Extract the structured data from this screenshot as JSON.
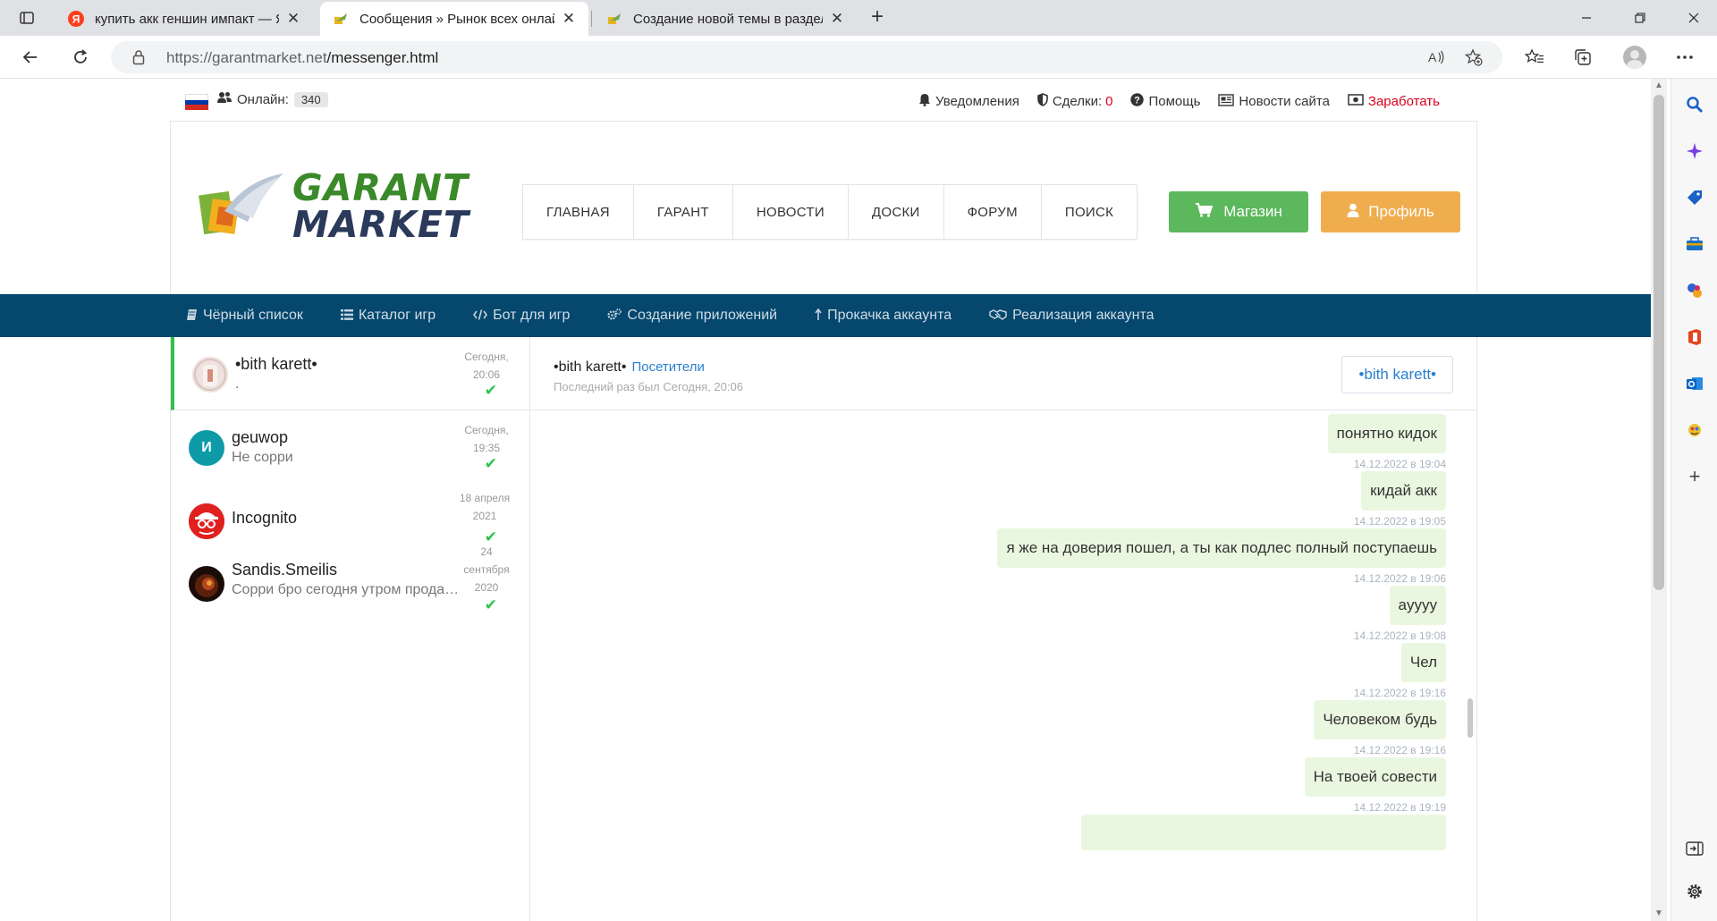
{
  "browser": {
    "tabs": [
      {
        "title": "купить акк геншин импакт — Ян",
        "favicon": "yandex-icon",
        "active": false
      },
      {
        "title": "Сообщения » Рынок всех онлай",
        "favicon": "garant-favicon",
        "active": true
      },
      {
        "title": "Создание новой темы в раздел",
        "favicon": "garant-favicon",
        "active": false
      }
    ],
    "url_host": "https://garantmarket.net",
    "url_path": "/messenger.html"
  },
  "site": {
    "online_label": "Онлайн:",
    "online_count": "340",
    "toplinks": {
      "notifications": "Уведомления",
      "deals_label": "Сделки:",
      "deals_count": "0",
      "help": "Помощь",
      "news": "Новости сайта",
      "earn": "Заработать"
    },
    "logo_line1": "GARANT",
    "logo_line2": "MARKET",
    "nav": [
      "ГЛАВНАЯ",
      "ГАРАНТ",
      "НОВОСТИ",
      "ДОСКИ",
      "ФОРУМ",
      "ПОИСК"
    ],
    "shop_button": "Магазин",
    "profile_button": "Профиль",
    "subnav": [
      "Чёрный список",
      "Каталог игр",
      "Бот для игр",
      "Создание приложений",
      "Прокачка аккаунта",
      "Реализация аккаунта"
    ]
  },
  "dialogs": [
    {
      "name": "•bith karett•",
      "preview": ".",
      "date": "Сегодня, 20:06"
    },
    {
      "name": "geuwop",
      "preview": "Не сорри",
      "date": "Сегодня, 19:35",
      "avatar_letter": "И"
    },
    {
      "name": "Incognito",
      "preview": "",
      "date": "18 апреля 2021"
    },
    {
      "name": "Sandis.Smeilis",
      "preview": "Сорри бро сегодня утром продал…",
      "date": "24 сентября 2020"
    }
  ],
  "chat": {
    "name": "•bith karett•",
    "role": "Посетители",
    "last_seen": "Последний раз был Сегодня, 20:06",
    "header_button": "•bith karett•",
    "messages": [
      {
        "text": "понятно кидок",
        "time": "14.12.2022 в 19:04"
      },
      {
        "text": "кидай акк",
        "time": "14.12.2022 в 19:05"
      },
      {
        "text": "я же на доверия пошел, а ты как подлес полный поступаешь",
        "time": "14.12.2022 в 19:06"
      },
      {
        "text": "ayyyy",
        "time": "14.12.2022 в 19:08"
      },
      {
        "text": "Чел",
        "time": "14.12.2022 в 19:16"
      },
      {
        "text": "Человеком будь",
        "time": "14.12.2022 в 19:16"
      },
      {
        "text": "На твоей совести",
        "time": "14.12.2022 в 19:19"
      }
    ]
  },
  "colors": {
    "accent_green": "#5cb85c",
    "accent_orange": "#f0ad4e",
    "subnav_bg": "#05476d",
    "bubble_bg": "#eaf7e0",
    "link_blue": "#2a7fcf",
    "earn_red": "#d9001b"
  }
}
